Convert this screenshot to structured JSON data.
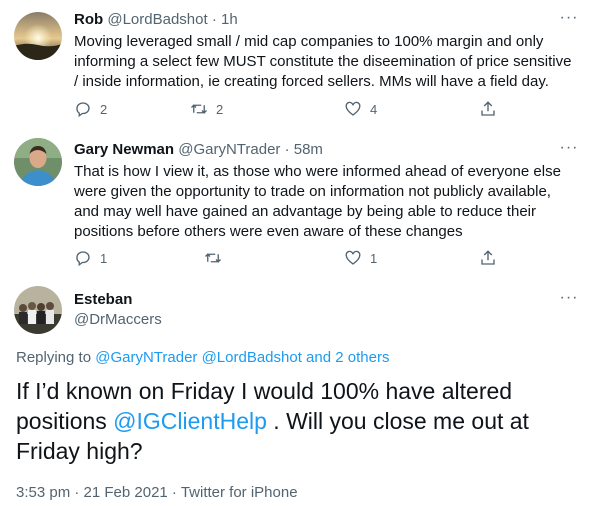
{
  "tweets": [
    {
      "name": "Rob",
      "handle": "@LordBadshot",
      "time": "· 1h",
      "text": "Moving leveraged small / mid cap companies to 100% margin and only informing a select few MUST constitute the diseemination of price sensitive / inside information, ie creating forced sellers. MMs will have a field day.",
      "replies": "2",
      "retweets": "2",
      "likes": "4"
    },
    {
      "name": "Gary Newman",
      "handle": "@GaryNTrader",
      "time": "· 58m",
      "text": "That is how I view it, as those who were informed ahead of everyone else were given the opportunity to trade on information not publicly available, and may well have gained an advantage by being able to reduce their positions before others were even aware of these changes",
      "replies": "1",
      "retweets": "",
      "likes": "1"
    }
  ],
  "main_tweet": {
    "name": "Esteban",
    "handle": "@DrMaccers",
    "replying_prefix": "Replying to",
    "replying_user1": "@GaryNTrader",
    "replying_user2": "@LordBadshot",
    "replying_others": "and 2 others",
    "text_part1": "If I’d known on Friday I would 100% have altered positions ",
    "mention": "@IGClientHelp",
    "text_part2": " . Will you close me out at Friday high?",
    "meta": "3:53 pm · 21 Feb 2021 · Twitter for iPhone"
  },
  "more_icon": "more-horizontal-icon",
  "colors": {
    "link": "#1d9bf0",
    "secondary": "#536471",
    "text": "#0f1419"
  }
}
